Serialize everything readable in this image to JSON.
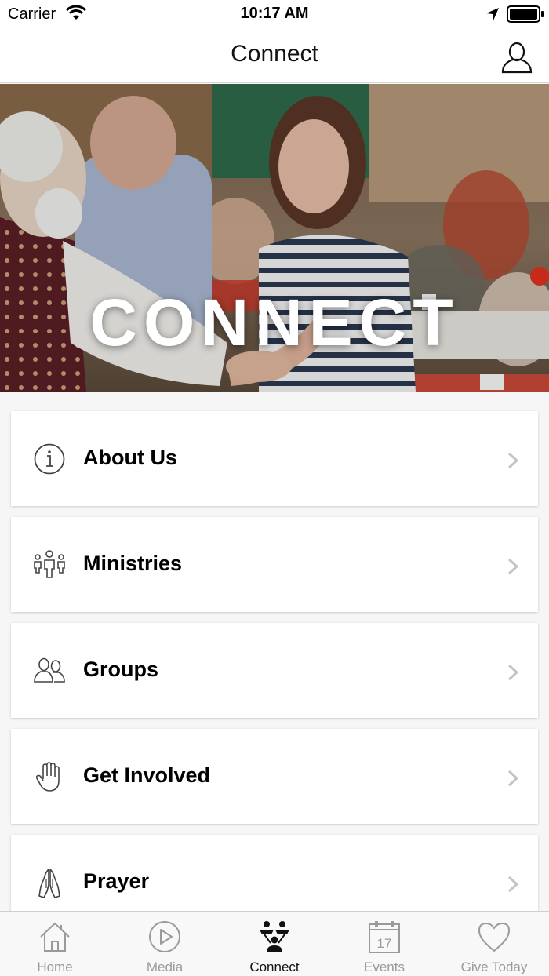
{
  "status_bar": {
    "carrier": "Carrier",
    "time": "10:17 AM"
  },
  "nav": {
    "title": "Connect",
    "profile_icon": "person-icon"
  },
  "hero": {
    "title": "CONNECT"
  },
  "menu": [
    {
      "label": "About Us",
      "icon": "info-icon"
    },
    {
      "label": "Ministries",
      "icon": "people-group-icon"
    },
    {
      "label": "Groups",
      "icon": "users-icon"
    },
    {
      "label": "Get Involved",
      "icon": "hand-icon"
    },
    {
      "label": "Prayer",
      "icon": "praying-hands-icon"
    }
  ],
  "tabs": [
    {
      "label": "Home",
      "icon": "home-icon"
    },
    {
      "label": "Media",
      "icon": "play-icon"
    },
    {
      "label": "Connect",
      "icon": "connect-icon",
      "active": true
    },
    {
      "label": "Events",
      "icon": "calendar-icon",
      "day": "17"
    },
    {
      "label": "Give Today",
      "icon": "heart-icon"
    }
  ],
  "colors": {
    "tab_inactive": "#9a9a9a",
    "tab_active": "#111111",
    "card_background": "#ffffff",
    "page_background": "#f6f6f6"
  }
}
